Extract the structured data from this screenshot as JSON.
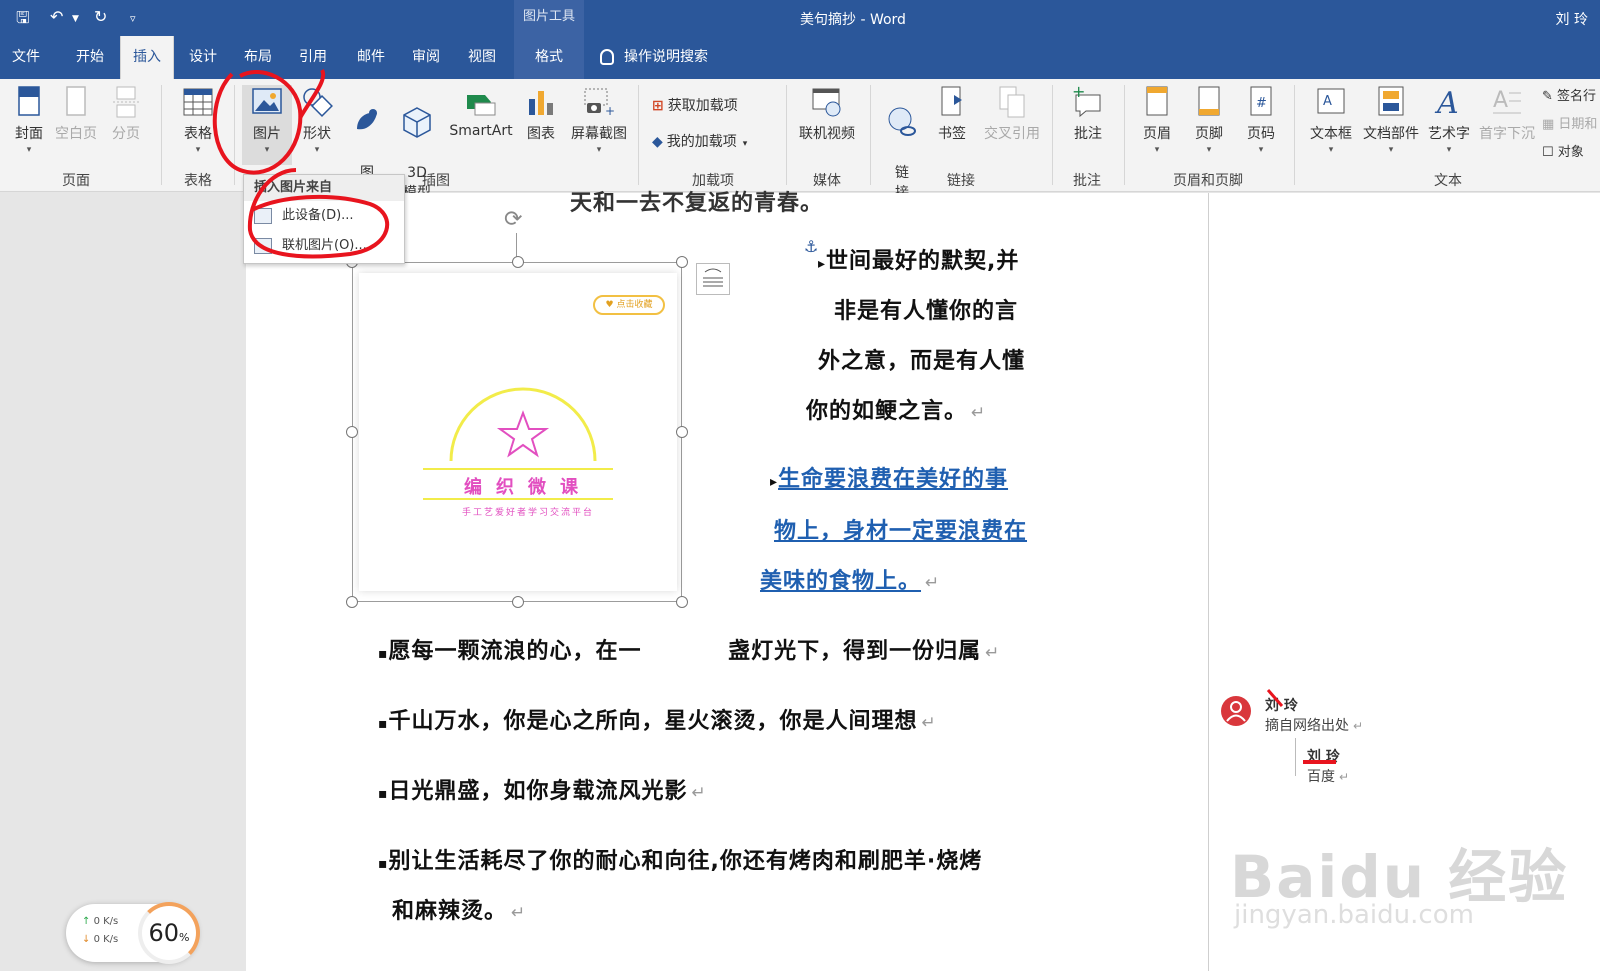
{
  "titlebar": {
    "context_tool": "图片工具",
    "title": "美句摘抄 - Word",
    "user": "刘 玲"
  },
  "tabs": [
    "文件",
    "开始",
    "插入",
    "设计",
    "布局",
    "引用",
    "邮件",
    "审阅",
    "视图",
    "格式"
  ],
  "active_tab": "插入",
  "search_label": "操作说明搜索",
  "ribbon": {
    "page_group": {
      "label": "页面",
      "buttons": [
        "封面",
        "空白页",
        "分页"
      ]
    },
    "table_group": {
      "label": "表格",
      "buttons": [
        "表格"
      ]
    },
    "illus_group": {
      "label": "插图",
      "buttons": [
        "图片",
        "形状",
        "图\n标",
        "3D\n模型",
        "SmartArt",
        "图表",
        "屏幕截图"
      ]
    },
    "addins_group": {
      "label": "加载项",
      "buttons": [
        "获取加载项",
        "我的加载项"
      ]
    },
    "media_group": {
      "label": "媒体",
      "buttons": [
        "联机视频"
      ]
    },
    "links_group": {
      "label": "链接",
      "buttons": [
        "链\n接",
        "书签",
        "交叉引用"
      ]
    },
    "comment_group": {
      "label": "批注",
      "buttons": [
        "批注"
      ]
    },
    "hf_group": {
      "label": "页眉和页脚",
      "buttons": [
        "页眉",
        "页脚",
        "页码"
      ]
    },
    "text_group": {
      "label": "文本",
      "buttons": [
        "文本框",
        "文档部件",
        "艺术字",
        "首字下沉"
      ],
      "side": [
        "签名行",
        "日期和",
        "对象"
      ]
    }
  },
  "dropdown": {
    "header": "插入图片来自",
    "items": [
      "此设备(D)...",
      "联机图片(O)..."
    ]
  },
  "doc": {
    "top_cut": "天和一去不复返的青春。",
    "right1": [
      "世间最好的默契,并",
      "非是有人懂你的言",
      "外之意，而是有人懂",
      "你的如鲠之言。"
    ],
    "right2": [
      "生命要浪费在美好的事",
      "物上，身材一定要浪费在",
      "美味的食物上。"
    ],
    "lines": [
      "愿每一颗流浪的心，在一          盏灯光下，得到一份归属",
      "千山万水，你是心之所向，星火滚烫，你是人间理想",
      "日光鼎盛，如你身载流风光影",
      "别让生活耗尽了你的耐心和向往,你还有烤肉和刷肥羊·烧烤",
      "和麻辣烫。"
    ],
    "image": {
      "fav": "♥ 点击收藏",
      "title": "编织微课",
      "subtitle": "手工艺爱好者学习交流平台"
    }
  },
  "comments": [
    {
      "author": "刘 玲",
      "text": "摘自网络出处"
    },
    {
      "author": "刘 玲",
      "text": "百度"
    }
  ],
  "net": {
    "up": "0  K/s",
    "down": "0  K/s",
    "percent": "60",
    "unit": "%"
  },
  "watermark": {
    "main": "Baidu 经验",
    "url": "jingyan.baidu.com"
  }
}
